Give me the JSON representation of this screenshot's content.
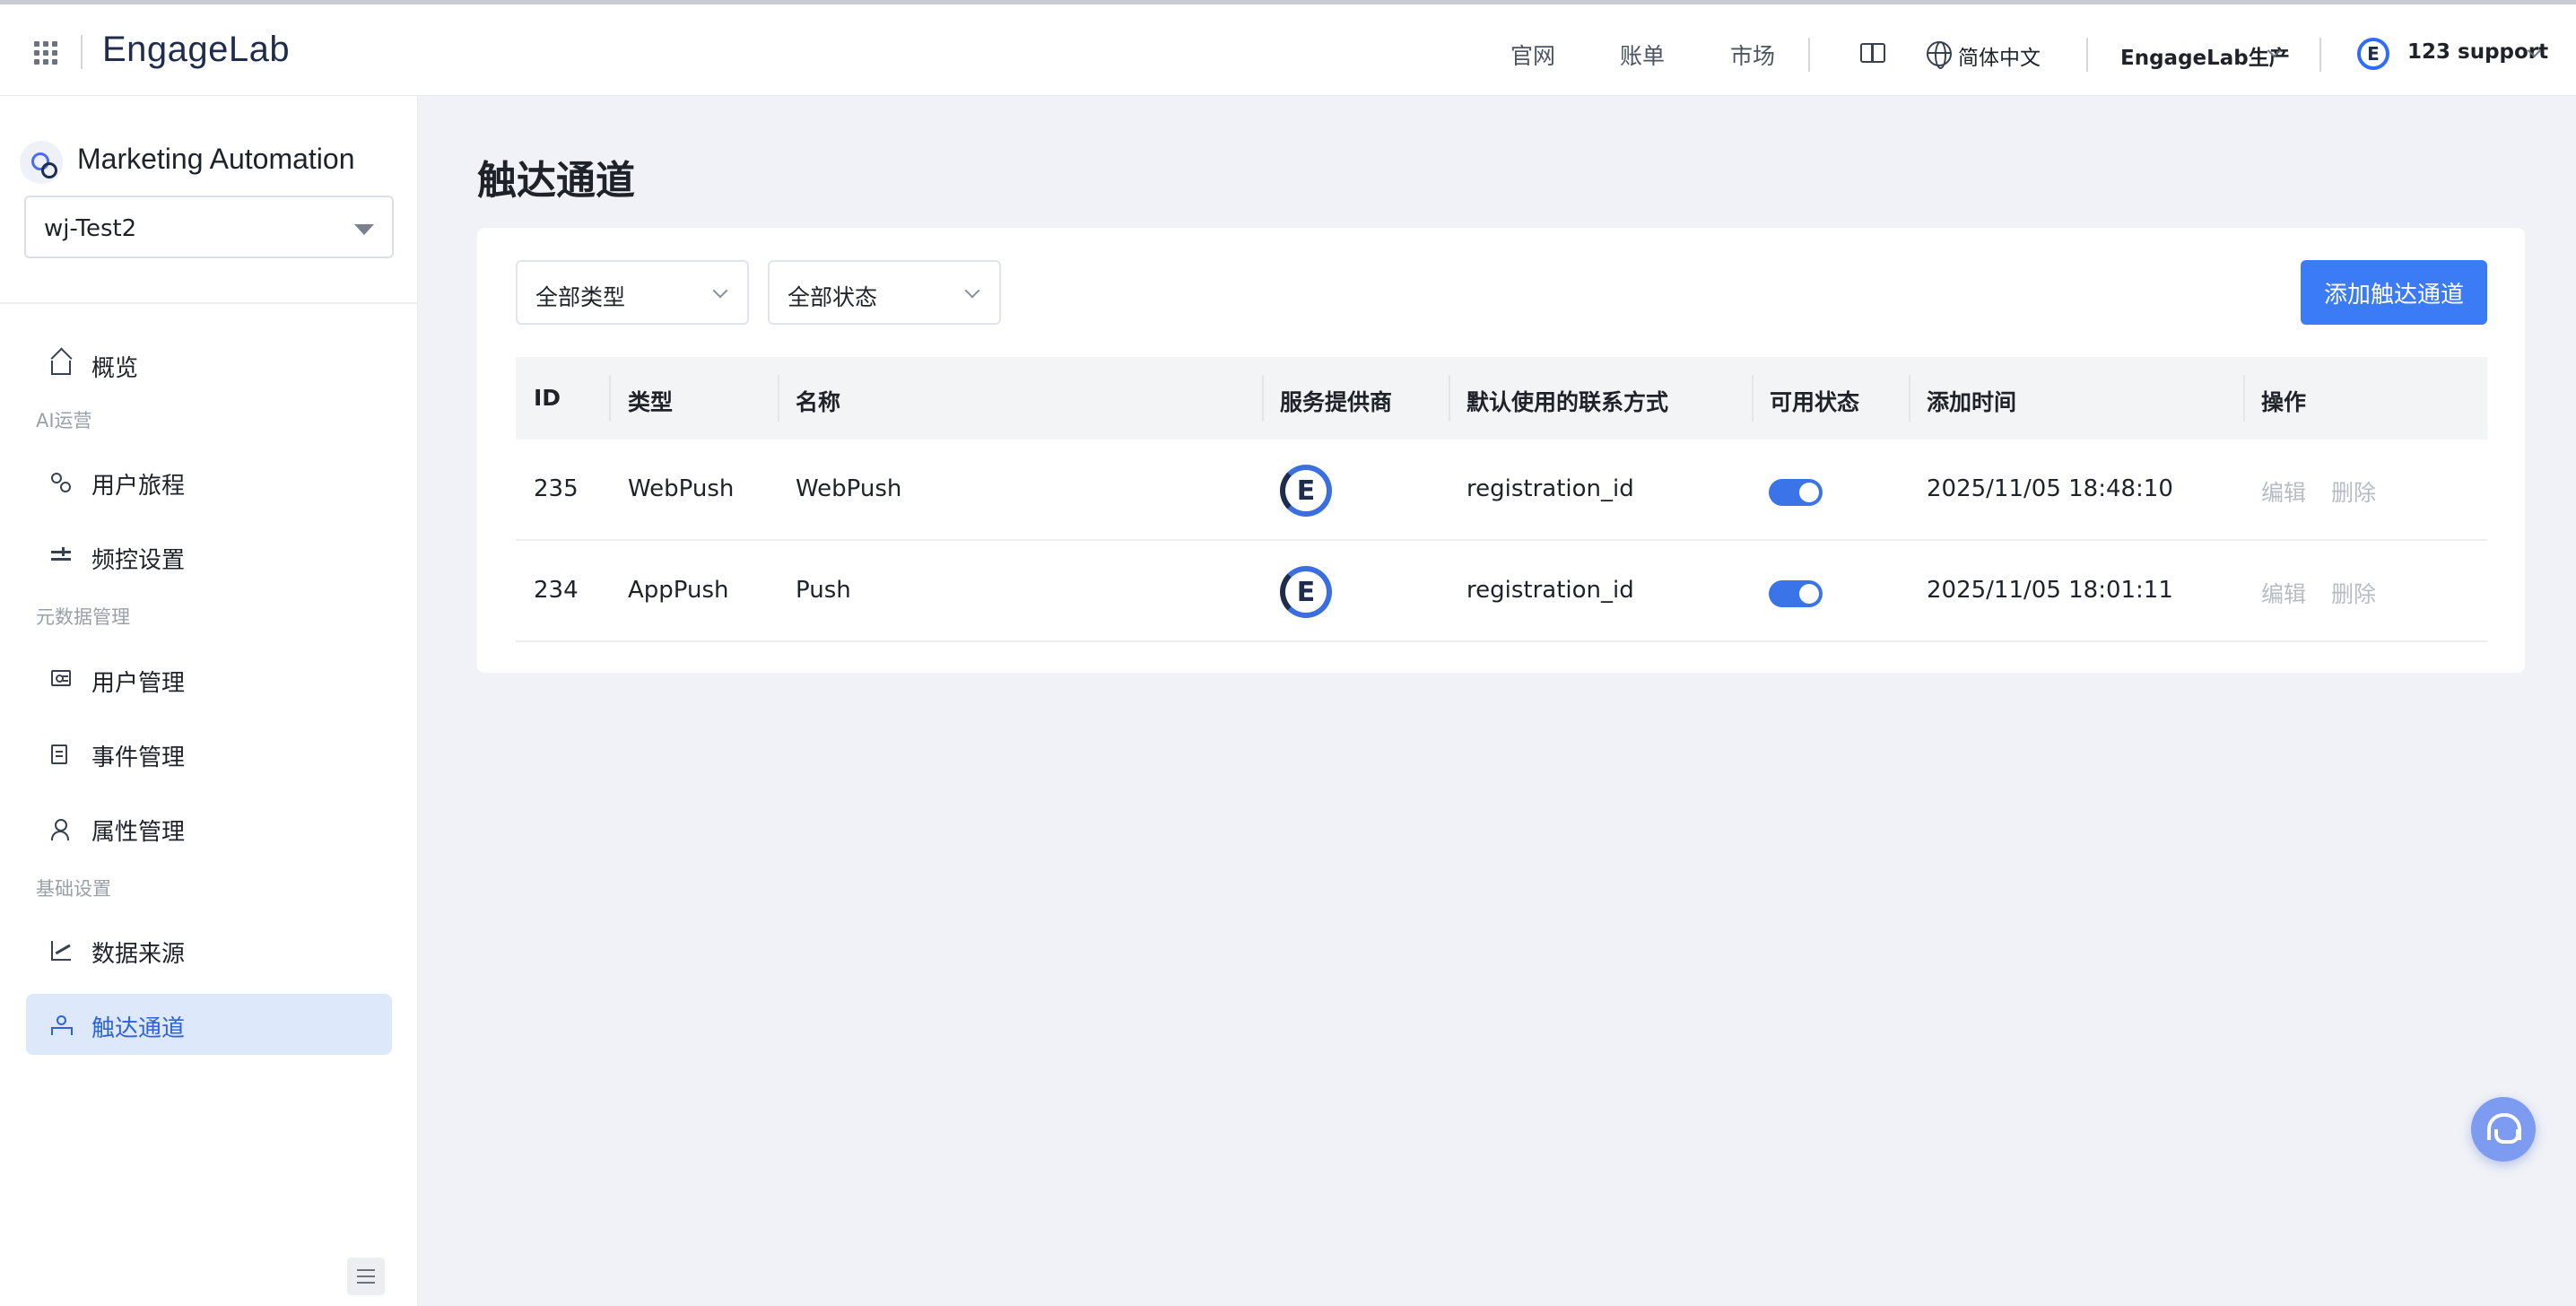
{
  "header": {
    "logo": "EngageLab",
    "nav": [
      "官网",
      "账单",
      "市场"
    ],
    "language": "简体中文",
    "environment": "EngageLab生产",
    "user_avatar_letter": "E",
    "user": "123 support"
  },
  "sidebar": {
    "app_title": "Marketing Automation",
    "project": "wj-Test2",
    "sections": {
      "ai": "AI运营",
      "meta": "元数据管理",
      "basic": "基础设置"
    },
    "items": [
      {
        "label": "概览",
        "icon": "home-icon"
      },
      {
        "label": "用户旅程",
        "icon": "flow-icon"
      },
      {
        "label": "频控设置",
        "icon": "slider-icon"
      },
      {
        "label": "用户管理",
        "icon": "id-card-icon"
      },
      {
        "label": "事件管理",
        "icon": "document-icon"
      },
      {
        "label": "属性管理",
        "icon": "user-icon"
      },
      {
        "label": "数据来源",
        "icon": "chart-icon"
      },
      {
        "label": "触达通道",
        "icon": "hub-icon",
        "active": true
      }
    ]
  },
  "main": {
    "title": "触达通道",
    "filters": {
      "type": "全部类型",
      "status": "全部状态"
    },
    "add_button": "添加触达通道",
    "table": {
      "columns": [
        "ID",
        "类型",
        "名称",
        "服务提供商",
        "默认使用的联系方式",
        "可用状态",
        "添加时间",
        "操作"
      ],
      "rows": [
        {
          "id": "235",
          "type": "WebPush",
          "name": "WebPush",
          "provider_letter": "E",
          "contact": "registration_id",
          "enabled": true,
          "added": "2025/11/05 18:48:10",
          "edit": "编辑",
          "delete": "删除"
        },
        {
          "id": "234",
          "type": "AppPush",
          "name": "Push",
          "provider_letter": "E",
          "contact": "registration_id",
          "enabled": true,
          "added": "2025/11/05 18:01:11",
          "edit": "编辑",
          "delete": "删除"
        }
      ]
    }
  },
  "colors": {
    "primary": "#3b7bf6",
    "active_bg": "#dde8fb",
    "active_text": "#2f62d9"
  }
}
